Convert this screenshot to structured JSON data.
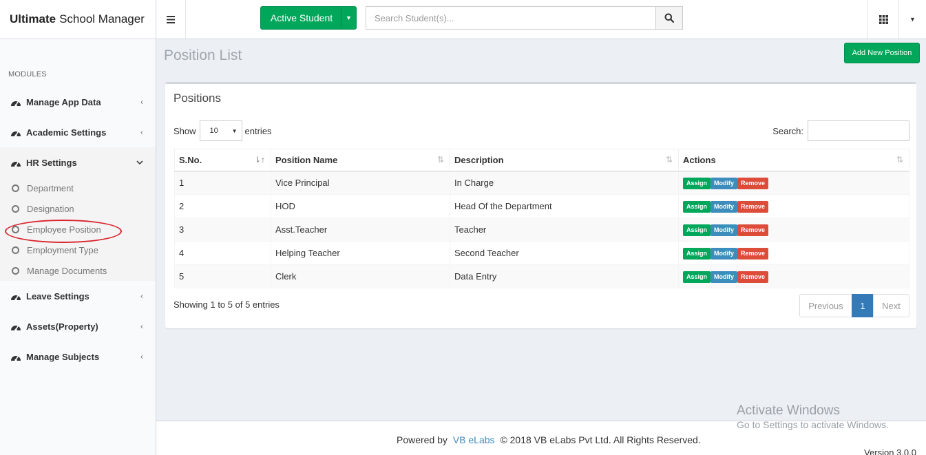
{
  "app": {
    "title_bold": "Ultimate",
    "title_rest": "School Manager"
  },
  "header": {
    "active_student_label": "Active Student",
    "search_placeholder": "Search Student(s)..."
  },
  "sidebar": {
    "modules_header": "MODULES",
    "items": [
      {
        "label": "Manage App Data"
      },
      {
        "label": "Academic Settings"
      },
      {
        "label": "HR Settings"
      },
      {
        "label": "Leave Settings"
      },
      {
        "label": "Assets(Property)"
      },
      {
        "label": "Manage Subjects"
      }
    ],
    "hr_submenu": [
      {
        "label": "Department"
      },
      {
        "label": "Designation"
      },
      {
        "label": "Employee Position"
      },
      {
        "label": "Employment Type"
      },
      {
        "label": "Manage Documents"
      }
    ]
  },
  "page": {
    "title": "Position List",
    "add_button": "Add New Position"
  },
  "box": {
    "title": "Positions",
    "show_label": "Show",
    "entries_label": "entries",
    "page_length": "10",
    "search_label": "Search:",
    "columns": [
      "S.No.",
      "Position Name",
      "Description",
      "Actions"
    ],
    "rows": [
      {
        "sno": "1",
        "name": "Vice Principal",
        "desc": "In Charge"
      },
      {
        "sno": "2",
        "name": "HOD",
        "desc": "Head Of the Department"
      },
      {
        "sno": "3",
        "name": "Asst.Teacher",
        "desc": "Teacher"
      },
      {
        "sno": "4",
        "name": "Helping Teacher",
        "desc": "Second Teacher"
      },
      {
        "sno": "5",
        "name": "Clerk",
        "desc": "Data Entry"
      }
    ],
    "actions": {
      "assign": "Assign",
      "modify": "Modify",
      "remove": "Remove"
    },
    "info": "Showing 1 to 5 of 5 entries",
    "pagination": {
      "previous": "Previous",
      "current": "1",
      "next": "Next"
    }
  },
  "footer": {
    "powered_by": "Powered by",
    "link": "VB eLabs",
    "copyright": "© 2018 VB eLabs Pvt Ltd. All Rights Reserved.",
    "version": "Version 3.0.0"
  },
  "watermark": {
    "line1": "Activate Windows",
    "line2": "Go to Settings to activate Windows."
  },
  "colors": {
    "success": "#00a65a",
    "primary": "#3c8dbc",
    "danger": "#dd4b39",
    "highlight_ellipse": "#d9262c"
  }
}
